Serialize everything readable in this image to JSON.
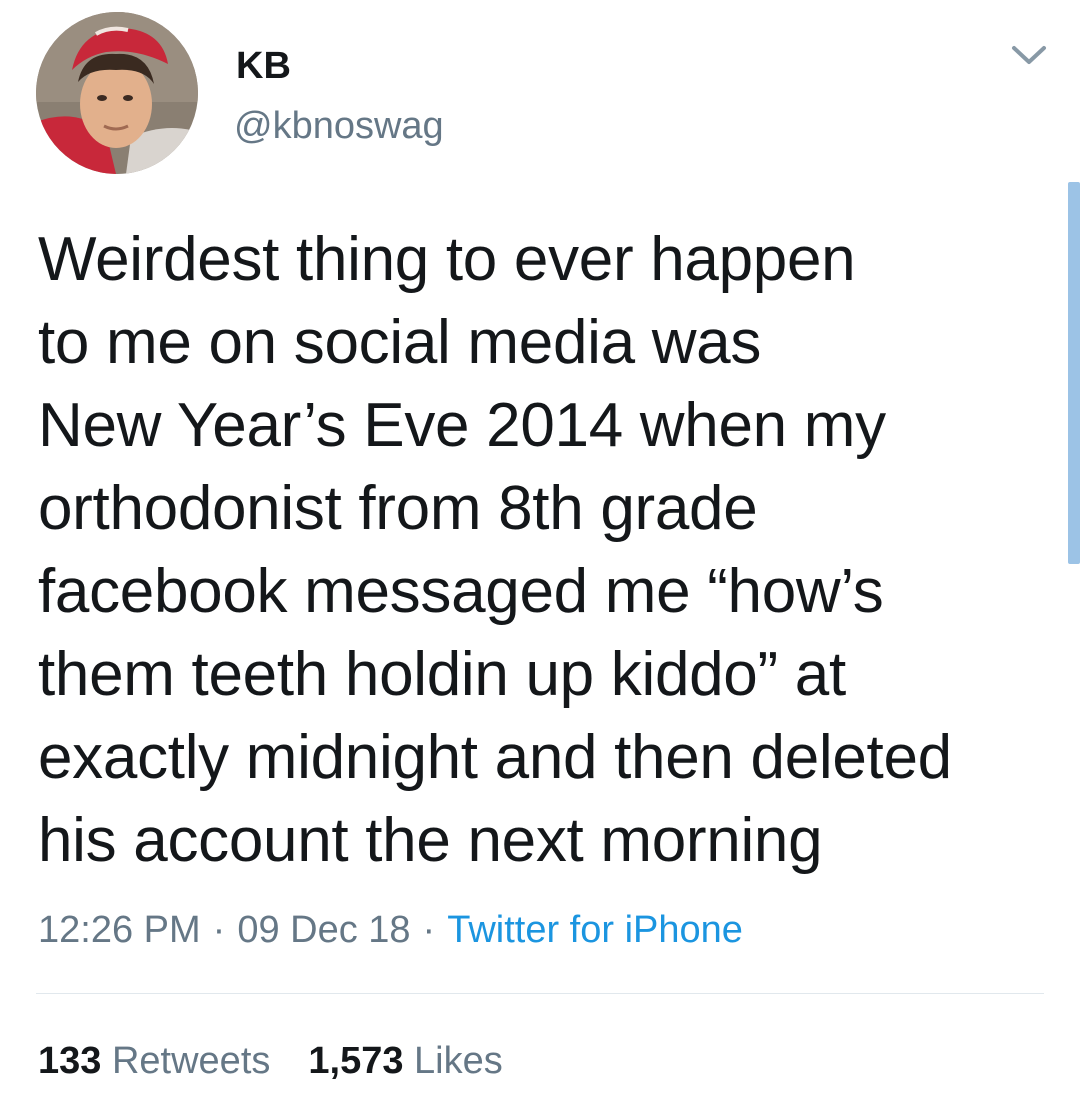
{
  "user": {
    "display_name": "KB",
    "handle": "@kbnoswag",
    "avatar_icon": "profile-photo"
  },
  "tweet": {
    "text": "Weirdest thing to ever happen\nto me on social media was\nNew Year’s Eve 2014 when my\northodonist from 8th grade\nfacebook messaged me “how’s\nthem teeth holdin up kiddo” at\nexactly midnight and then deleted\nhis account the next morning",
    "time": "12:26 PM",
    "separator": "·",
    "date": "09 Dec 18",
    "source": "Twitter for iPhone"
  },
  "stats": {
    "retweets_count": "133",
    "retweets_label": "Retweets",
    "likes_count": "1,573",
    "likes_label": "Likes"
  },
  "menu": {
    "icon": "chevron-down-icon"
  },
  "colors": {
    "text_primary": "#14171a",
    "text_secondary": "#657786",
    "link": "#1b95e0",
    "divider": "#e1e8ed",
    "scroll_indicator": "#9cc3e6"
  }
}
